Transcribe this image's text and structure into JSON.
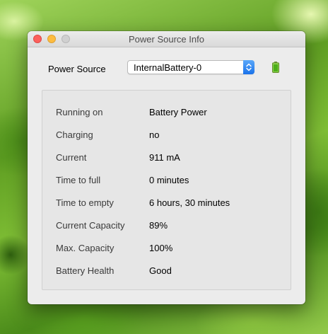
{
  "window": {
    "title": "Power Source Info"
  },
  "source": {
    "label": "Power Source",
    "selected": "InternalBattery-0",
    "icon": "battery-icon"
  },
  "info": {
    "rows": [
      {
        "label": "Running on",
        "value": "Battery Power"
      },
      {
        "label": "Charging",
        "value": "no"
      },
      {
        "label": "Current",
        "value": "911 mA"
      },
      {
        "label": "Time to full",
        "value": "0 minutes"
      },
      {
        "label": "Time to empty",
        "value": "6 hours, 30 minutes"
      },
      {
        "label": "Current Capacity",
        "value": "89%"
      },
      {
        "label": "Max. Capacity",
        "value": "100%"
      },
      {
        "label": "Battery Health",
        "value": "Good"
      }
    ]
  },
  "colors": {
    "close": "#fc605c",
    "minimize": "#fdbc40",
    "zoom": "#d0d0d0",
    "popup_accent": "#1a72ea",
    "battery": "#4caf1a"
  }
}
